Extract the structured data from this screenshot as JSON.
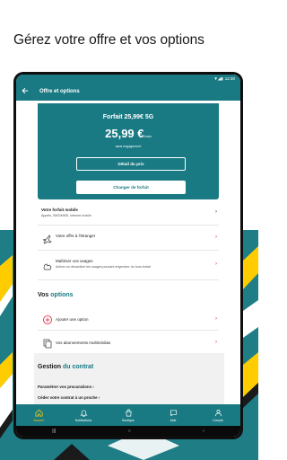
{
  "headline": "Gérez votre offre et vos options",
  "statusbar": {
    "icons": "▼◢▮",
    "time": "12:30"
  },
  "appbar": {
    "back_icon": "arrow-left-icon",
    "title": "Offre et options"
  },
  "offer": {
    "name": "Forfait 25,99€ 5G",
    "price": "25,99 €",
    "price_period": "/mois",
    "commitment": "sans engagement",
    "detail_button": "Détail du prix",
    "change_button": "Changer de forfait"
  },
  "forfait_row": {
    "title": "Votre forfait mobile",
    "subtitle": "Appels, SMS/MMS, internet mobile"
  },
  "abroad_row": {
    "title": "Votre offre à l'étranger"
  },
  "usage_row": {
    "title": "Maîtriser vos usages",
    "subtitle": "Activer ou désactiver les usages pouvant engendrer du hors-forfait"
  },
  "options_section": {
    "prefix": "Vos",
    "accent": "options"
  },
  "add_option_row": {
    "title": "Ajouter une option"
  },
  "subscriptions_row": {
    "title": "Vos abonnements multimédias"
  },
  "contract_section": {
    "prefix": "Gestion",
    "accent": "du contrat",
    "link_procurations": "Paramétrer vos procurations",
    "link_cede": "Céder votre contrat à un proche"
  },
  "bottom_nav": [
    {
      "label": "Accueil",
      "icon": "home-icon",
      "active": true
    },
    {
      "label": "Notifications",
      "icon": "bell-icon",
      "active": false
    },
    {
      "label": "Boutique",
      "icon": "shop-bag-icon",
      "active": false
    },
    {
      "label": "Aide",
      "icon": "chat-help-icon",
      "active": false
    },
    {
      "label": "Compte",
      "icon": "user-icon",
      "active": false
    }
  ],
  "system_nav": {
    "recents": "|||",
    "home": "○",
    "back": "‹"
  },
  "colors": {
    "teal": "#1a7a83",
    "red": "#d6213b",
    "yellow": "#ffcc00"
  }
}
